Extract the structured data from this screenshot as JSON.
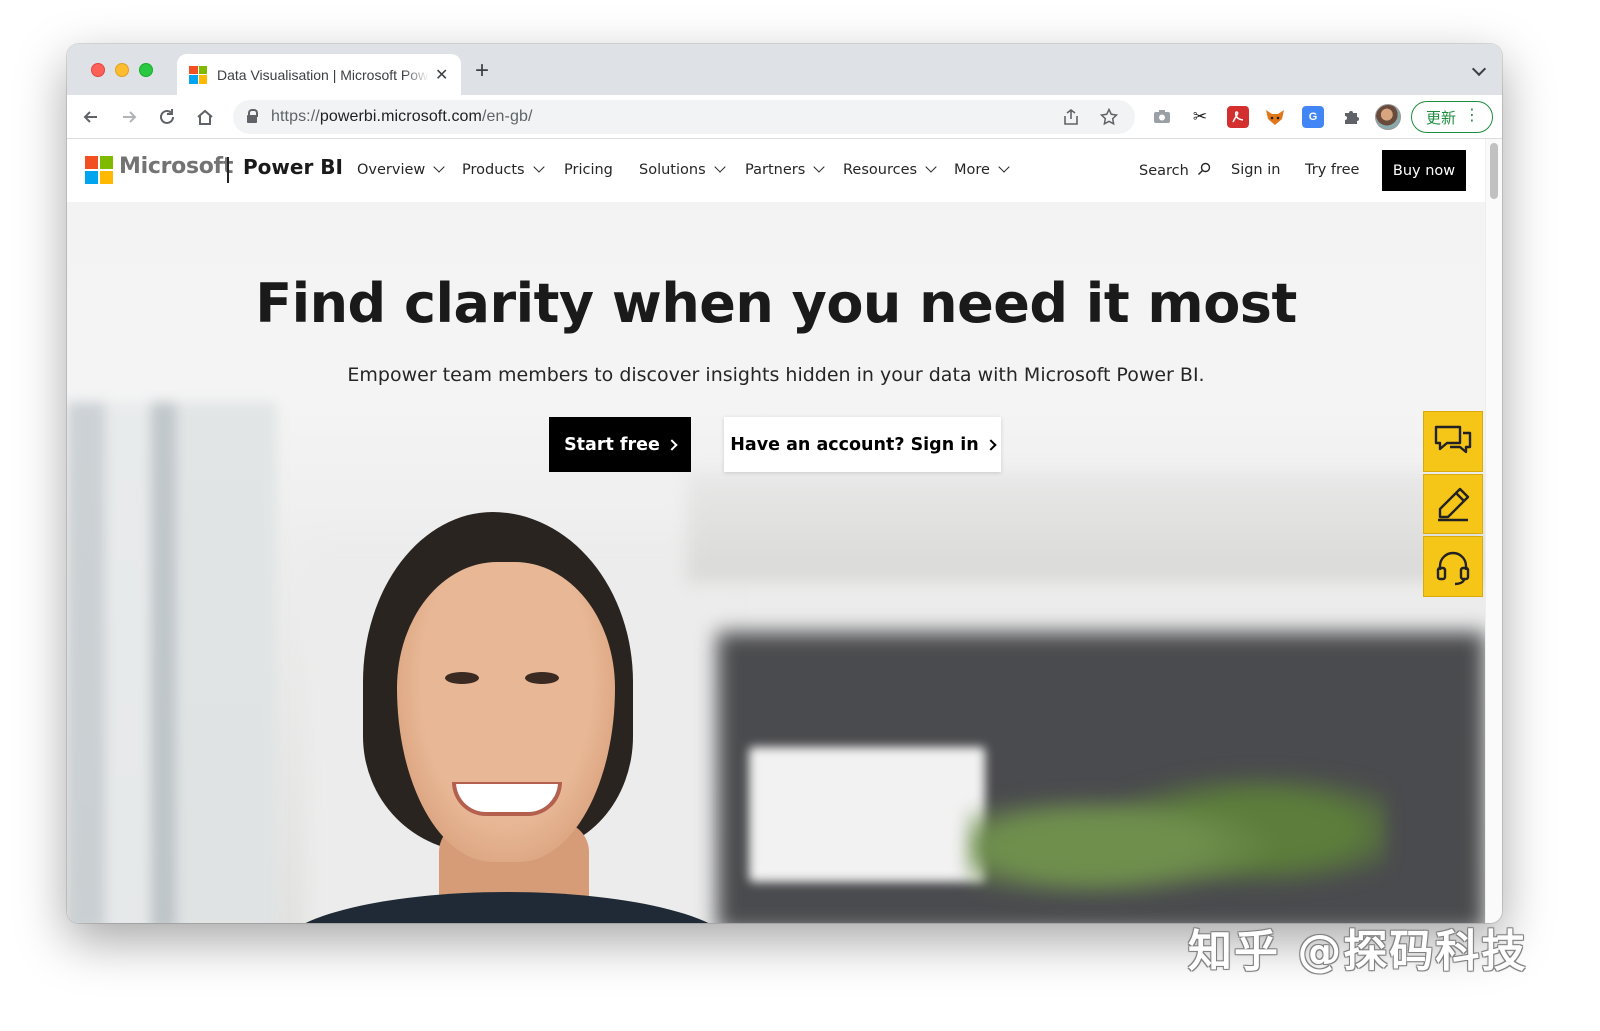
{
  "browser": {
    "tab_title": "Data Visualisation | Microsoft Power BI",
    "url_scheme": "https://",
    "url_host": "powerbi.microsoft.com",
    "url_path": "/en-gb/",
    "update_label": "更新",
    "extensions": [
      "camera-icon",
      "scissors-icon",
      "pdf-icon",
      "fox-icon",
      "translate-icon",
      "puzzle-icon"
    ]
  },
  "nav": {
    "brand": "Microsoft",
    "product": "Power BI",
    "items": [
      {
        "label": "Overview",
        "dropdown": true
      },
      {
        "label": "Products",
        "dropdown": true
      },
      {
        "label": "Pricing",
        "dropdown": false
      },
      {
        "label": "Solutions",
        "dropdown": true
      },
      {
        "label": "Partners",
        "dropdown": true
      },
      {
        "label": "Resources",
        "dropdown": true
      },
      {
        "label": "More",
        "dropdown": true
      }
    ],
    "search_label": "Search",
    "sign_in_label": "Sign in",
    "try_free_label": "Try free",
    "buy_now_label": "Buy now"
  },
  "hero": {
    "title": "Find clarity when you need it most",
    "subtitle": "Empower team members to discover insights hidden in your data with Microsoft Power BI.",
    "primary_cta": "Start free",
    "secondary_cta": "Have an account? Sign in"
  },
  "side_widgets": [
    "chat-icon",
    "pencil-icon",
    "headset-icon"
  ],
  "watermark": "知乎 @探码科技",
  "colors": {
    "ms_red": "#f25022",
    "ms_green": "#7fba00",
    "ms_blue": "#00a4ef",
    "ms_yellow": "#ffb900",
    "widget_yellow": "#f5c518",
    "update_green": "#1e8e3e"
  }
}
